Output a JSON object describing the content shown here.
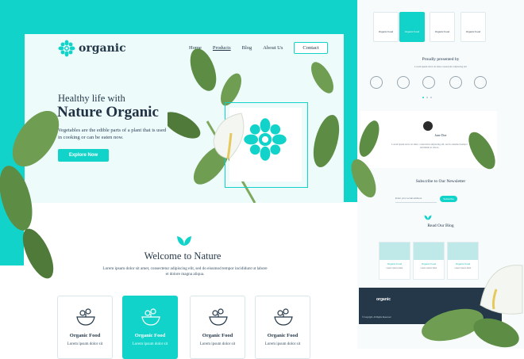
{
  "header": {
    "logo_text": "organic",
    "nav": [
      "Home",
      "Products",
      "Blog",
      "About Us"
    ],
    "contact_label": "Contact"
  },
  "hero": {
    "subtitle": "Healthy life with",
    "title": "Nature Organic",
    "description": "Vegetables are the edible parts of a plant that is used in cooking or can be eaten now.",
    "cta_label": "Explore Now"
  },
  "welcome": {
    "title": "Welcome to Nature",
    "description": "Lorem ipsum dolor sit amet, consectetur adipiscing elit, sed do eiusmod tempor incididunt ut labore et dolore magna aliqua."
  },
  "cards": [
    {
      "title": "Organic Food",
      "desc": "Lorem ipsum dolor sit"
    },
    {
      "title": "Organic Food",
      "desc": "Lorem ipsum dolor sit"
    },
    {
      "title": "Organic Food",
      "desc": "Lorem ipsum dolor sit"
    },
    {
      "title": "Organic Food",
      "desc": "Lorem ipsum dolor sit"
    }
  ],
  "side": {
    "mini_cards": [
      "Organic Food",
      "Organic Food",
      "Organic Food",
      "Organic Food"
    ],
    "partners_title": "Proudly presented by",
    "partners_desc": "Lorem ipsum dolor sit amet consectetur adipiscing elit",
    "testimonial_name": "Jane Doe",
    "testimonial_text": "Lorem ipsum dolor sit amet, consectetur adipiscing elit, sed do eiusmod tempor incididunt ut labore.",
    "newsletter_title": "Subscribe to Our Newsletter",
    "newsletter_placeholder": "Enter your email address",
    "newsletter_button": "Subscribe",
    "blog_title": "Read Our Blog",
    "blog_posts": [
      {
        "title": "Organic Food",
        "date": "Lorem ipsum dolor"
      },
      {
        "title": "Organic Food",
        "date": "Lorem ipsum dolor"
      },
      {
        "title": "Organic Food",
        "date": "Lorem ipsum dolor"
      }
    ],
    "footer_logo": "organic",
    "footer_copy": "© Copyright. All Rights Reserved"
  },
  "colors": {
    "accent": "#12d3c9",
    "dark": "#24384a",
    "leaf": "#4f7a3a"
  }
}
